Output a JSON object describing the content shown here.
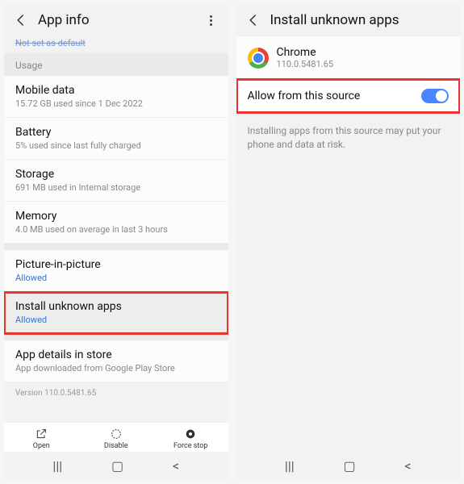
{
  "left": {
    "header": {
      "title": "App info"
    },
    "cut_text": "Not set as default",
    "usage_label": "Usage",
    "items": {
      "mobile_data": {
        "title": "Mobile data",
        "sub": "15.72 GB used since 1 Dec 2022"
      },
      "battery": {
        "title": "Battery",
        "sub": "5% used since last fully charged"
      },
      "storage": {
        "title": "Storage",
        "sub": "691 MB used in Internal storage"
      },
      "memory": {
        "title": "Memory",
        "sub": "4.0 MB used on average in last 3 hours"
      },
      "pip": {
        "title": "Picture-in-picture",
        "sub": "Allowed"
      },
      "unknown": {
        "title": "Install unknown apps",
        "sub": "Allowed"
      },
      "details": {
        "title": "App details in store",
        "sub": "App downloaded from Google Play Store"
      }
    },
    "version": "Version 110.0.5481.65",
    "actions": {
      "open": "Open",
      "disable": "Disable",
      "force_stop": "Force stop"
    }
  },
  "right": {
    "header": {
      "title": "Install unknown apps"
    },
    "app": {
      "name": "Chrome",
      "version": "110.0.5481.65"
    },
    "toggle_label": "Allow from this source",
    "warning": "Installing apps from this source may put your phone and data at risk."
  }
}
